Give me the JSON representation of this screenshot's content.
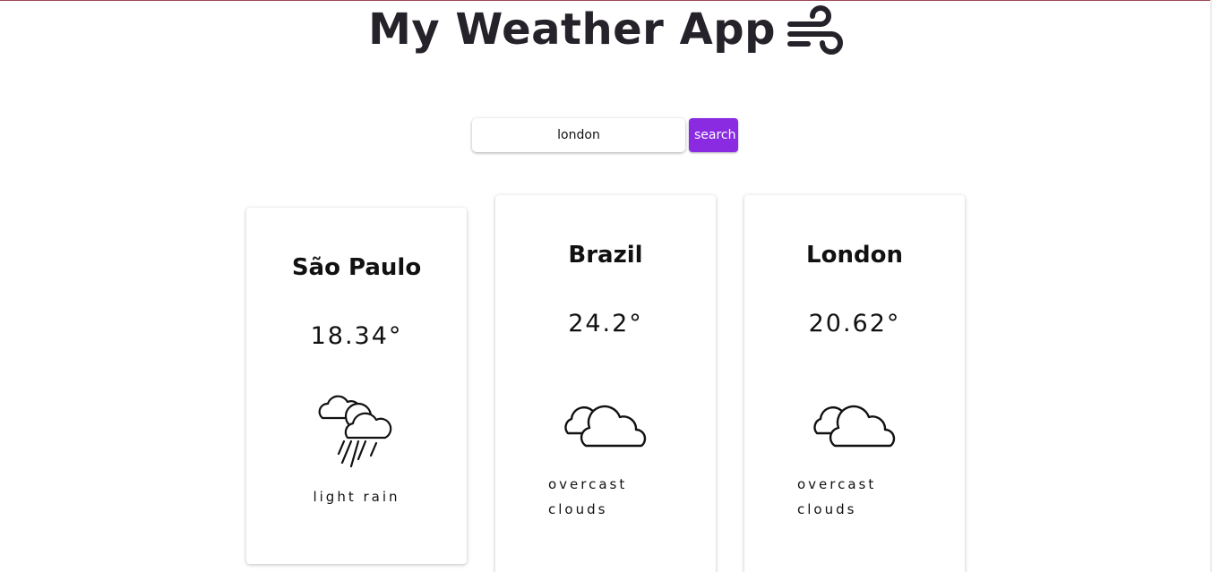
{
  "header": {
    "title": "My Weather App",
    "title_icon": "wind-icon"
  },
  "search": {
    "value": "london",
    "placeholder": "",
    "button_label": "search",
    "button_color": "#8a2be2"
  },
  "cards": [
    {
      "city": "São Paulo",
      "temperature": "18.34°",
      "icon": "cloud-sun-rain-icon",
      "description": "light rain"
    },
    {
      "city": "Brazil",
      "temperature": "24.2°",
      "icon": "clouds-icon",
      "description": "overcast clouds"
    },
    {
      "city": "London",
      "temperature": "20.62°",
      "icon": "clouds-icon",
      "description": "overcast clouds"
    }
  ]
}
